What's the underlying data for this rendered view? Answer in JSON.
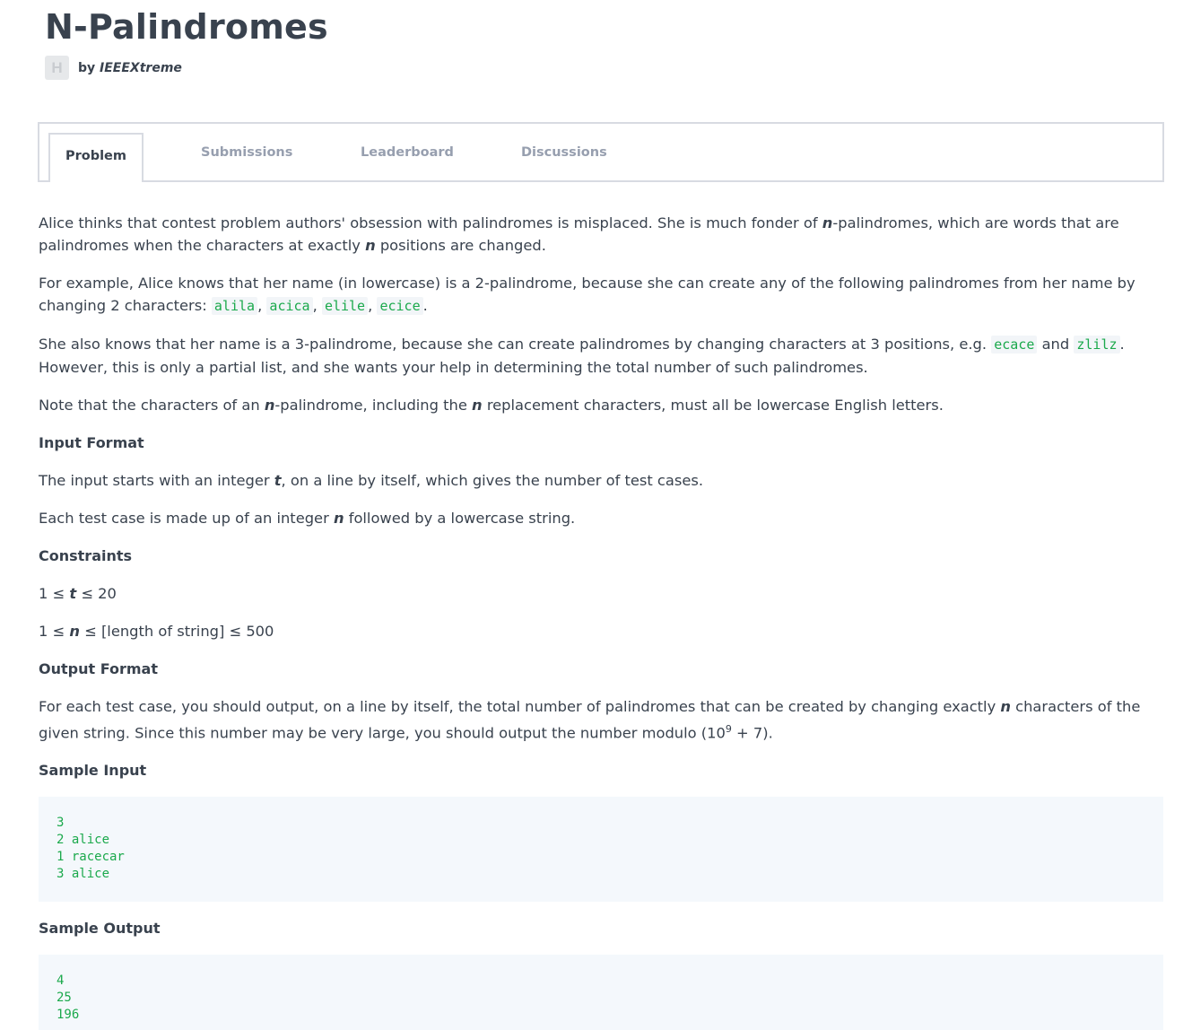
{
  "header": {
    "title": "N-Palindromes",
    "avatar_letter": "H",
    "by_label": "by",
    "author": "IEEEXtreme"
  },
  "tabs": [
    "Problem",
    "Submissions",
    "Leaderboard",
    "Discussions"
  ],
  "problem": {
    "p1_a": "Alice thinks that contest problem authors' obsession with palindromes is misplaced. She is much fonder of ",
    "p1_n": "n",
    "p1_b": "-palindromes, which are words that are palindromes when the characters at exactly ",
    "p1_n2": "n",
    "p1_c": " positions are changed.",
    "p2_a": "For example, Alice knows that her name (in lowercase) is a 2-palindrome, because she can create any of the following palindromes from her name by changing 2 characters: ",
    "p2_codes": [
      "alila",
      "acica",
      "elile",
      "ecice"
    ],
    "p3_a": "She also knows that her name is a 3-palindrome, because she can create palindromes by changing characters at 3 positions, e.g. ",
    "p3_code1": "ecace",
    "p3_and": " and ",
    "p3_code2": "zlilz",
    "p3_b": ". However, this is only a partial list, and she wants your help in determining the total number of such palindromes.",
    "p4_a": "Note that the characters of an ",
    "p4_n": "n",
    "p4_b": "-palindrome, including the ",
    "p4_n2": "n",
    "p4_c": " replacement characters, must all be lowercase English letters.",
    "input_heading": "Input Format",
    "in1_a": "The input starts with an integer ",
    "in1_t": "t",
    "in1_b": ", on a line by itself, which gives the number of test cases.",
    "in2_a": "Each test case is made up of an integer ",
    "in2_n": "n",
    "in2_b": " followed by a lowercase string.",
    "constraints_heading": "Constraints",
    "c1_a": "1 ≤ ",
    "c1_t": "t",
    "c1_b": " ≤ 20",
    "c2_a": "1 ≤ ",
    "c2_n": "n",
    "c2_b": " ≤ [length of string] ≤ 500",
    "output_heading": "Output Format",
    "out_a": "For each test case, you should output, on a line by itself, the total number of palindromes that can be created by changing exactly ",
    "out_n": "n",
    "out_b": " characters of the given string. Since this number may be very large, you should output the number modulo (10",
    "out_sup": "9",
    "out_c": " + 7).",
    "sample_input_heading": "Sample Input",
    "sample_input": "3\n2 alice\n1 racecar\n3 alice",
    "sample_output_heading": "Sample Output",
    "sample_output": "4\n25\n196"
  }
}
